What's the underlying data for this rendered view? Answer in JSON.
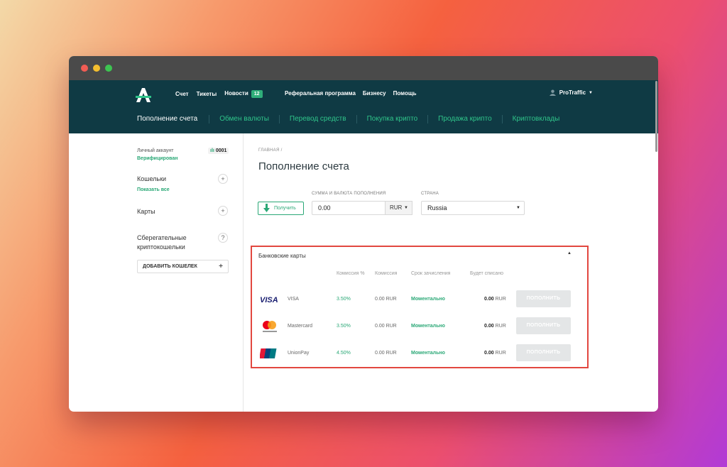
{
  "header": {
    "nav": [
      "Счет",
      "Тикеты",
      "Новости"
    ],
    "news_count": "12",
    "nav2": [
      "Реферальная программа",
      "Бизнесу",
      "Помощь"
    ],
    "user": "ProTraffic"
  },
  "subnav": [
    "Пополнение счета",
    "Обмен валюты",
    "Перевод средств",
    "Покупка крипто",
    "Продажа крипто",
    "Криптовклады"
  ],
  "sidebar": {
    "account_label": "Личный аккаунт",
    "account_status": "Верифицирован",
    "account_id": "0001",
    "wallets_title": "Кошельки",
    "wallets_link": "Показать все",
    "cards_title": "Карты",
    "savings_title_1": "Сберегательные",
    "savings_title_2": "криптокошельки",
    "add_wallet": "ДОБАВИТЬ КОШЕЛЕК",
    "plus": "+",
    "help": "?"
  },
  "main": {
    "breadcrumb": "ГЛАВНАЯ /",
    "title": "Пополнение счета",
    "get_button": "Получить",
    "amount_label": "СУММА И ВАЛЮТА ПОПОЛНЕНИЯ",
    "amount_value": "0.00",
    "currency": "RUR",
    "country_label": "СТРАНА",
    "country": "Russia"
  },
  "cards": {
    "title": "Банковские карты",
    "columns": [
      "Комиссия %",
      "Комиссия",
      "Срок зачисления",
      "Будет списано"
    ],
    "rows": [
      {
        "logo": "visa-logo",
        "name": "VISA",
        "pct": "3.50%",
        "fee": "0.00 RUR",
        "time": "Моментально",
        "amount": "0.00",
        "currency": "RUR",
        "button": "ПОПОЛНИТЬ"
      },
      {
        "logo": "mastercard-logo",
        "name": "Mastercard",
        "pct": "3.50%",
        "fee": "0.00 RUR",
        "time": "Моментально",
        "amount": "0.00",
        "currency": "RUR",
        "button": "ПОПОЛНИТЬ"
      },
      {
        "logo": "unionpay-logo",
        "name": "UnionPay",
        "pct": "4.50%",
        "fee": "0.00 RUR",
        "time": "Моментально",
        "amount": "0.00",
        "currency": "RUR",
        "button": "ПОПОЛНИТЬ"
      }
    ]
  },
  "colors": {
    "header_bg": "#0f3a44",
    "accent": "#2aa876",
    "highlight": "#e2473f"
  }
}
